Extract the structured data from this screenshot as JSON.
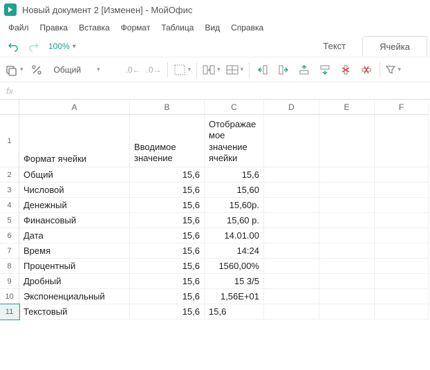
{
  "window": {
    "title": "Новый документ 2 [Изменен] - МойОфис"
  },
  "menu": {
    "file": "Файл",
    "edit": "Правка",
    "insert": "Вставка",
    "format": "Формат",
    "table": "Таблица",
    "view": "Вид",
    "help": "Справка"
  },
  "quick": {
    "zoom": "100%"
  },
  "tabs": {
    "text": "Текст",
    "cell": "Ячейка"
  },
  "toolbar": {
    "number_format": "Общий",
    "decrease_dec": ".0←",
    "increase_dec": ".0→"
  },
  "formulabar": {
    "fx": "fx",
    "value": ""
  },
  "grid": {
    "columns": [
      "A",
      "B",
      "C",
      "D",
      "E",
      "F"
    ],
    "header": {
      "A": "Формат ячейки",
      "B": "Вводимое значение",
      "C": "Отображаемое значение ячейки"
    },
    "rows": [
      {
        "n": "2",
        "A": "Общий",
        "B": "15,6",
        "C": "15,6",
        "C_align": "num"
      },
      {
        "n": "3",
        "A": "Числовой",
        "B": "15,6",
        "C": "15,60",
        "C_align": "num"
      },
      {
        "n": "4",
        "A": "Денежный",
        "B": "15,6",
        "C": "15,60р.",
        "C_align": "num"
      },
      {
        "n": "5",
        "A": "Финансовый",
        "B": "15,6",
        "C": "15,60  р.",
        "C_align": "num"
      },
      {
        "n": "6",
        "A": "Дата",
        "B": "15,6",
        "C": "14.01.00",
        "C_align": "num"
      },
      {
        "n": "7",
        "A": "Время",
        "B": "15,6",
        "C": "14:24",
        "C_align": "num"
      },
      {
        "n": "8",
        "A": "Процентный",
        "B": "15,6",
        "C": "1560,00%",
        "C_align": "num"
      },
      {
        "n": "9",
        "A": "Дробный",
        "B": "15,6",
        "C": "15 3/5",
        "C_align": "num"
      },
      {
        "n": "10",
        "A": "Экспоненциальный",
        "B": "15,6",
        "C": "1,56E+01",
        "C_align": "num"
      },
      {
        "n": "11",
        "A": "Текстовый",
        "B": "15,6",
        "C": "15,6",
        "C_align": "text",
        "selected": true
      }
    ]
  }
}
